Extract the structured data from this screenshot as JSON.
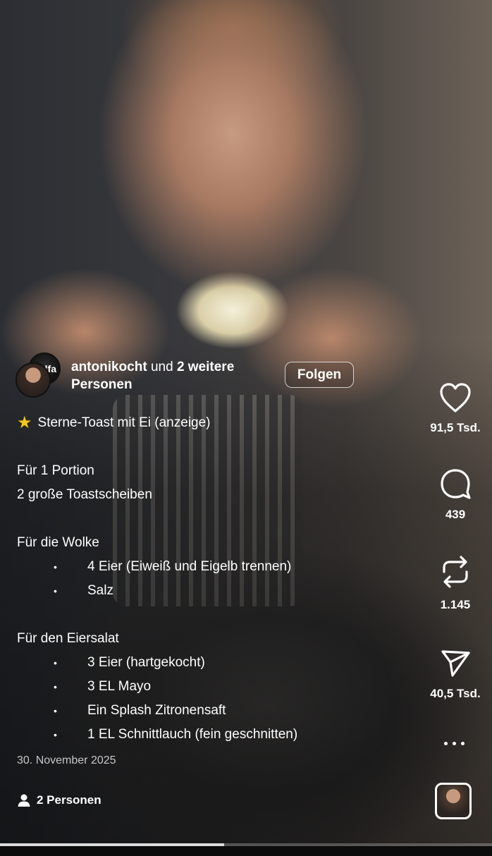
{
  "post": {
    "author_name": "antonikocht",
    "author_join": " und ",
    "author_others": "2 weitere Personen",
    "avatar_text": "lfa",
    "follow_label": "Folgen",
    "caption": {
      "title_icon": "star-emoji",
      "title": "Sterne-Toast mit Ei (anzeige)",
      "portion": "Für 1 Portion",
      "toast": "2 große Toastscheiben",
      "section1": "Für die Wolke",
      "section1_items": [
        "4 Eier (Eiweiß und Eigelb trennen)",
        "Salz"
      ],
      "section2": "Für den Eiersalat",
      "section2_items": [
        "3 Eier (hartgekocht)",
        "3 EL Mayo",
        "Ein Splash Zitronensaft",
        "1 EL Schnittlauch (fein geschnitten)"
      ]
    },
    "date": "30. November 2025",
    "persons_label": "2 Personen"
  },
  "actions": {
    "like_count": "91,5 Tsd.",
    "comment_count": "439",
    "repost_count": "1.145",
    "share_count": "40,5 Tsd."
  },
  "video_progress": 0.455,
  "colors": {
    "text": "#ffffff",
    "star": "#f5c518"
  }
}
